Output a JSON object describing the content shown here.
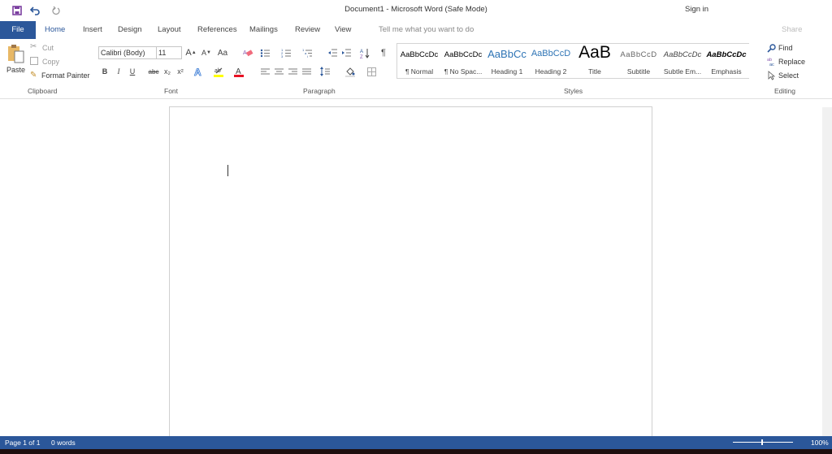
{
  "window": {
    "title": "Document1  -  Microsoft Word (Safe Mode)",
    "sign_in": "Sign in"
  },
  "quick_access": {
    "save_icon": "save-icon",
    "undo_icon": "undo-icon",
    "redo_icon": "redo-icon"
  },
  "tabs": [
    {
      "label": "File"
    },
    {
      "label": "Home"
    },
    {
      "label": "Insert"
    },
    {
      "label": "Design"
    },
    {
      "label": "Layout"
    },
    {
      "label": "References"
    },
    {
      "label": "Mailings"
    },
    {
      "label": "Review"
    },
    {
      "label": "View"
    }
  ],
  "tell_me": "Tell me what you want to do",
  "share": "Share",
  "clipboard": {
    "paste": "Paste",
    "cut": "Cut",
    "copy": "Copy",
    "format_painter": "Format Painter",
    "group_label": "Clipboard"
  },
  "font": {
    "family": "Calibri (Body)",
    "size": "11",
    "grow": "A",
    "shrink": "A",
    "change_case": "Aa",
    "bold": "B",
    "italic": "I",
    "underline": "U",
    "strikethrough": "abc",
    "subscript": "x₂",
    "superscript": "x²",
    "highlight_color": "#ffff00",
    "font_color": "#e81123",
    "group_label": "Font"
  },
  "paragraph": {
    "pilcrow": "¶",
    "group_label": "Paragraph"
  },
  "styles": {
    "items": [
      {
        "preview": "AaBbCcDc",
        "name": "¶ Normal"
      },
      {
        "preview": "AaBbCcDc",
        "name": "¶ No Spac..."
      },
      {
        "preview": "AaBbCc",
        "name": "Heading 1"
      },
      {
        "preview": "AaBbCcD",
        "name": "Heading 2"
      },
      {
        "preview": "AaB",
        "name": "Title"
      },
      {
        "preview": "AaBbCcD",
        "name": "Subtitle"
      },
      {
        "preview": "AaBbCcDc",
        "name": "Subtle Em..."
      },
      {
        "preview": "AaBbCcDc",
        "name": "Emphasis"
      }
    ],
    "group_label": "Styles"
  },
  "editing": {
    "find": "Find",
    "replace": "Replace",
    "select": "Select",
    "group_label": "Editing"
  },
  "status": {
    "page": "Page 1 of 1",
    "words": "0 words",
    "zoom": "100%",
    "zoom_level_percent": 100
  },
  "colors": {
    "accent": "#2b579a"
  }
}
